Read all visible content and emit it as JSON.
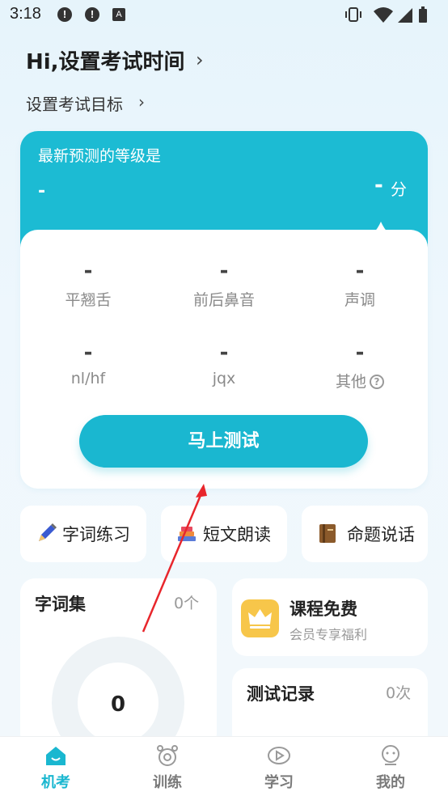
{
  "status_bar": {
    "time": "3:18",
    "alert_glyph": "!",
    "a_glyph": "A",
    "icons": [
      "alert-icon",
      "alert-icon",
      "a-notification-icon",
      "vibrate-icon",
      "wifi-icon",
      "signal-icon",
      "battery-icon"
    ]
  },
  "header": {
    "title": "Hi,设置考试时间",
    "subtitle": "设置考试目标"
  },
  "prediction_card": {
    "label": "最新预测的等级是",
    "level_value": "-",
    "score_value": "-",
    "score_unit": "分",
    "metrics": [
      {
        "value": "-",
        "label": "平翘舌"
      },
      {
        "value": "-",
        "label": "前后鼻音"
      },
      {
        "value": "-",
        "label": "声调"
      },
      {
        "value": "-",
        "label": "nl/hf"
      },
      {
        "value": "-",
        "label": "jqx"
      },
      {
        "value": "-",
        "label": "其他"
      }
    ],
    "help_glyph": "?",
    "test_button": "马上测试"
  },
  "quick_tiles": [
    {
      "label": "字词练习",
      "icon": "pen-icon"
    },
    {
      "label": "短文朗读",
      "icon": "books-icon"
    },
    {
      "label": "命题说话",
      "icon": "notebook-icon"
    }
  ],
  "word_set": {
    "title": "字词集",
    "count": "0个",
    "ring_value": "0"
  },
  "course": {
    "title": "课程免费",
    "subtitle": "会员专享福利",
    "icon": "crown-icon",
    "accent": "#f7c64a"
  },
  "test_record": {
    "title": "测试记录",
    "count": "0次"
  },
  "bottom_nav": [
    {
      "label": "机考",
      "icon": "exam-icon",
      "active": true
    },
    {
      "label": "训练",
      "icon": "alarm-clock-icon",
      "active": false
    },
    {
      "label": "学习",
      "icon": "play-icon",
      "active": false
    },
    {
      "label": "我的",
      "icon": "profile-icon",
      "active": false
    }
  ],
  "colors": {
    "accent": "#1ab7d0",
    "arrow": "#e8262c"
  }
}
